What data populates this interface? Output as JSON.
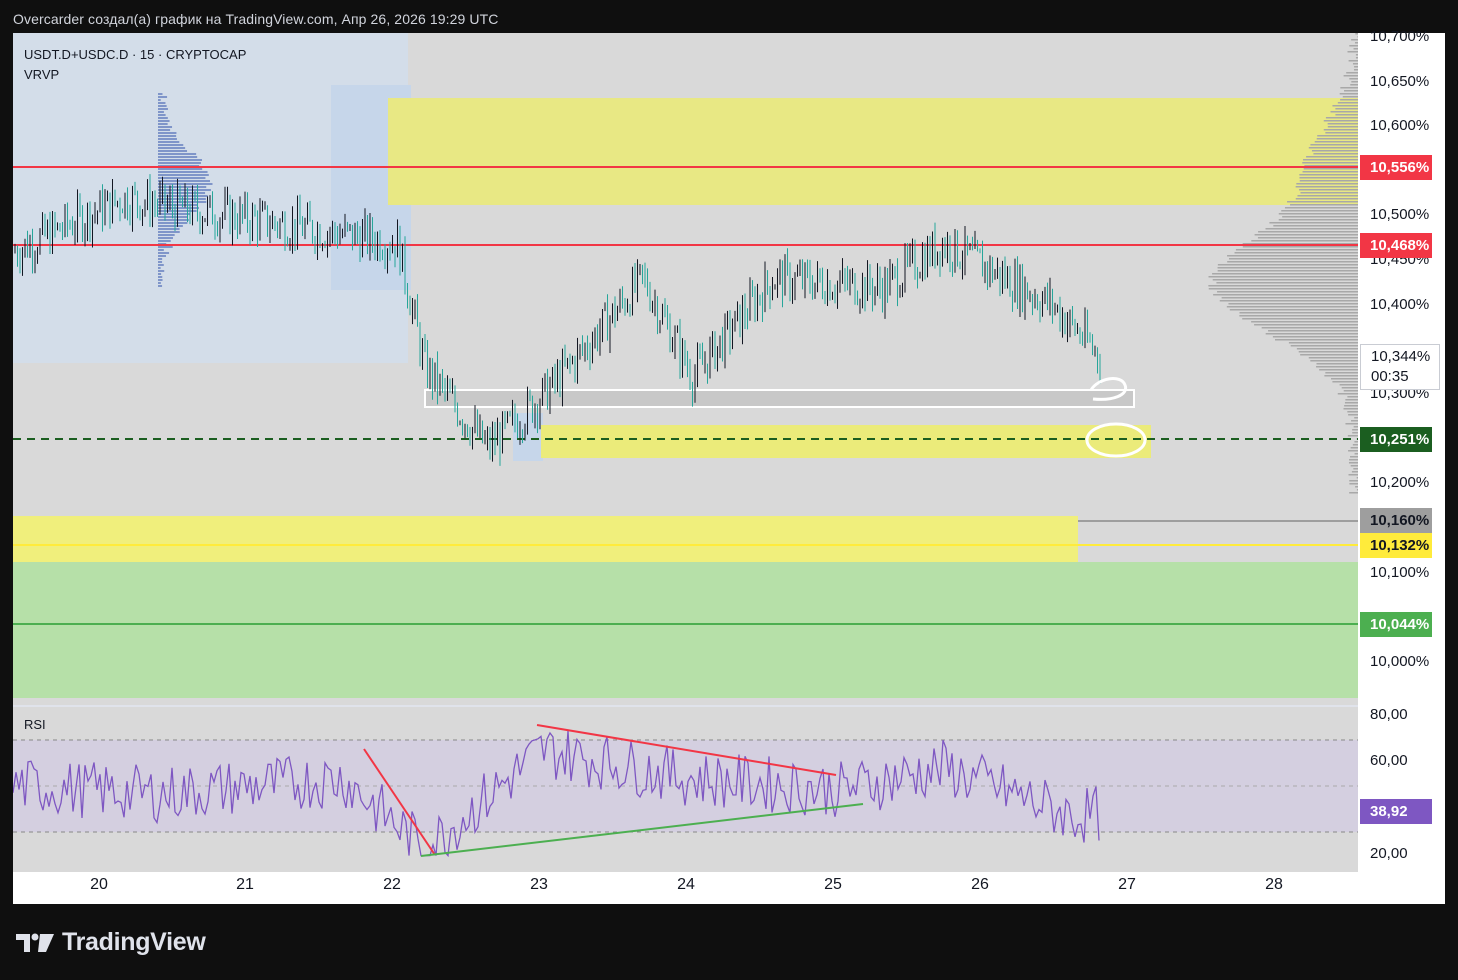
{
  "header": {
    "attribution": "Overcarder создал(а) график на TradingView.com, Апр 26, 2026 19:29 UTC"
  },
  "legend": {
    "symbol": "USDT.D+USDC.D · 15 · CRYPTOCAP",
    "indicator": "VRVP"
  },
  "rsi": {
    "label": "RSI",
    "value_badge": "38,92",
    "axis_ticks": [
      "80,00",
      "60,00",
      "20,00"
    ]
  },
  "price_axis": {
    "ticks": [
      "10,700%",
      "10,650%",
      "10,600%",
      "10,500%",
      "10,450%",
      "10,400%",
      "10,300%",
      "10,200%",
      "10,100%",
      "10,000%"
    ],
    "last_price": "10,344%",
    "countdown": "00:35"
  },
  "badges": {
    "b1": "10,556%",
    "b2": "10,468%",
    "b3": "10,251%",
    "b4": "10,160%",
    "b5": "10,132%",
    "b6": "10,044%"
  },
  "time_axis": [
    "20",
    "21",
    "22",
    "23",
    "24",
    "25",
    "26",
    "27",
    "28"
  ],
  "footer": {
    "brand": "TradingView"
  },
  "colors": {
    "red_level": "#f23645",
    "green_level": "#4caf50",
    "dashed_level": "#1b5e20",
    "yellow_zone": "#e7e984",
    "green_zone": "#b7e0a9",
    "rsi_line": "#7e57c2",
    "candle_up": "#26a69a",
    "candle_down": "#131722"
  },
  "chart_data": {
    "type": "line",
    "title": "USDT.D+USDC.D · 15 · CRYPTOCAP",
    "x": [
      "20",
      "21",
      "22",
      "22",
      "23",
      "23",
      "24",
      "24",
      "25",
      "25",
      "26",
      "26",
      "26"
    ],
    "series": [
      {
        "values": [
          10.46,
          10.52,
          10.47,
          10.33,
          10.24,
          10.31,
          10.43,
          10.32,
          10.43,
          10.42,
          10.47,
          10.4,
          10.34
        ]
      }
    ],
    "ylim": [
      9.96,
      10.71
    ],
    "levels": [
      10.556,
      10.468,
      10.251,
      10.16,
      10.132,
      10.044
    ],
    "zones": [
      [
        10.515,
        10.635
      ],
      [
        10.235,
        10.27
      ],
      [
        10.115,
        10.165
      ],
      [
        9.965,
        10.115
      ]
    ],
    "rsi": {
      "ylim": [
        18,
        84
      ],
      "bands": [
        30,
        50,
        70
      ],
      "x": [
        "20",
        "21",
        "22",
        "22",
        "23",
        "24",
        "25",
        "26",
        "26",
        "26"
      ],
      "values": [
        52,
        48,
        55,
        23,
        68,
        55,
        50,
        60,
        38,
        38.92
      ]
    }
  }
}
